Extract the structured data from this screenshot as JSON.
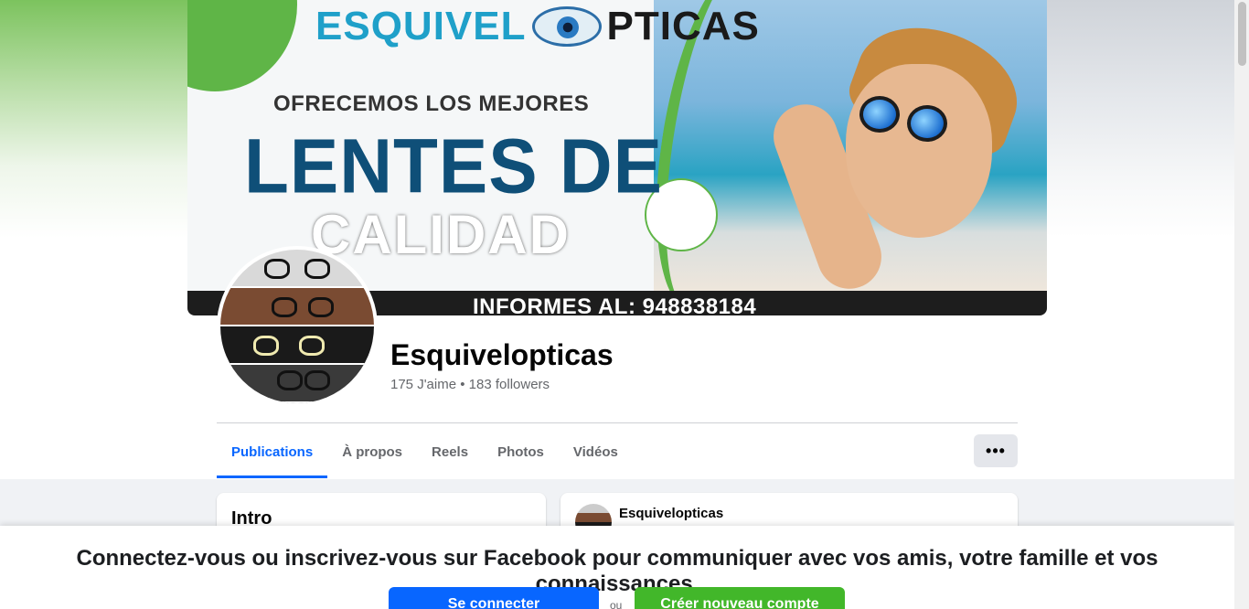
{
  "cover": {
    "brand_left": "ESQUIVEL",
    "brand_right": "PTICAS",
    "tagline": "OFRECEMOS LOS MEJORES",
    "headline_1": "LENTES DE",
    "headline_2": "CALIDAD",
    "contact": "INFORMES AL: 948838184"
  },
  "profile": {
    "name": "Esquivelopticas",
    "stats": "175 J'aime • 183 followers"
  },
  "tabs": [
    {
      "label": "Publications",
      "active": true
    },
    {
      "label": "À propos",
      "active": false
    },
    {
      "label": "Reels",
      "active": false
    },
    {
      "label": "Photos",
      "active": false
    },
    {
      "label": "Vidéos",
      "active": false
    }
  ],
  "more_button": "•••",
  "intro": {
    "title": "Intro"
  },
  "post": {
    "author": "Esquivelopticas"
  },
  "login_banner": {
    "message": "Connectez-vous ou inscrivez-vous sur Facebook pour communiquer avec vos amis, votre famille et vos connaissances.",
    "login_label": "Se connecter",
    "or_label": "ou",
    "signup_label": "Créer nouveau compte"
  },
  "colors": {
    "accent": "#0866ff",
    "signup": "#42b72a",
    "brand_teal": "#1fa0c9",
    "brand_green": "#5fb547",
    "headline_navy": "#0f4f78"
  }
}
